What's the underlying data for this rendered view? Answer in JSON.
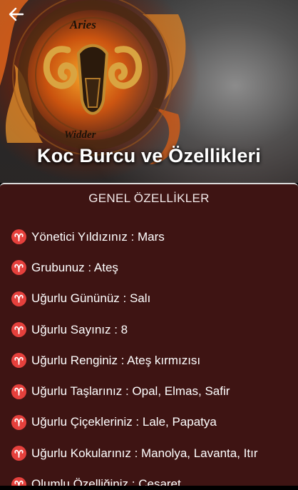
{
  "header": {
    "title": "Koc Burcu ve Özellikleri",
    "back_icon": "arrow-left-icon",
    "illustration_text_top": "Aries",
    "illustration_text_bottom": "Widder"
  },
  "section": {
    "title": "GENEL ÖZELLİKLER",
    "bullet_icon": "aries-symbol-icon",
    "bullet_color": "#e5403c",
    "background_color": "#3e1413"
  },
  "items": [
    {
      "label": "Yönetici Yıldızınız : Mars"
    },
    {
      "label": "Grubunuz : Ateş"
    },
    {
      "label": "Uğurlu Gününüz : Salı"
    },
    {
      "label": "Uğurlu Sayınız : 8"
    },
    {
      "label": "Uğurlu Renginiz : Ateş kırmızısı"
    },
    {
      "label": "Uğurlu Taşlarınız : Opal, Elmas, Safir"
    },
    {
      "label": "Uğurlu Çiçekleriniz : Lale, Papatya"
    },
    {
      "label": "Uğurlu Kokularınız : Manolya, Lavanta, Itır"
    },
    {
      "label": "Olumlu Özelliğiniz : Cesaret"
    }
  ]
}
